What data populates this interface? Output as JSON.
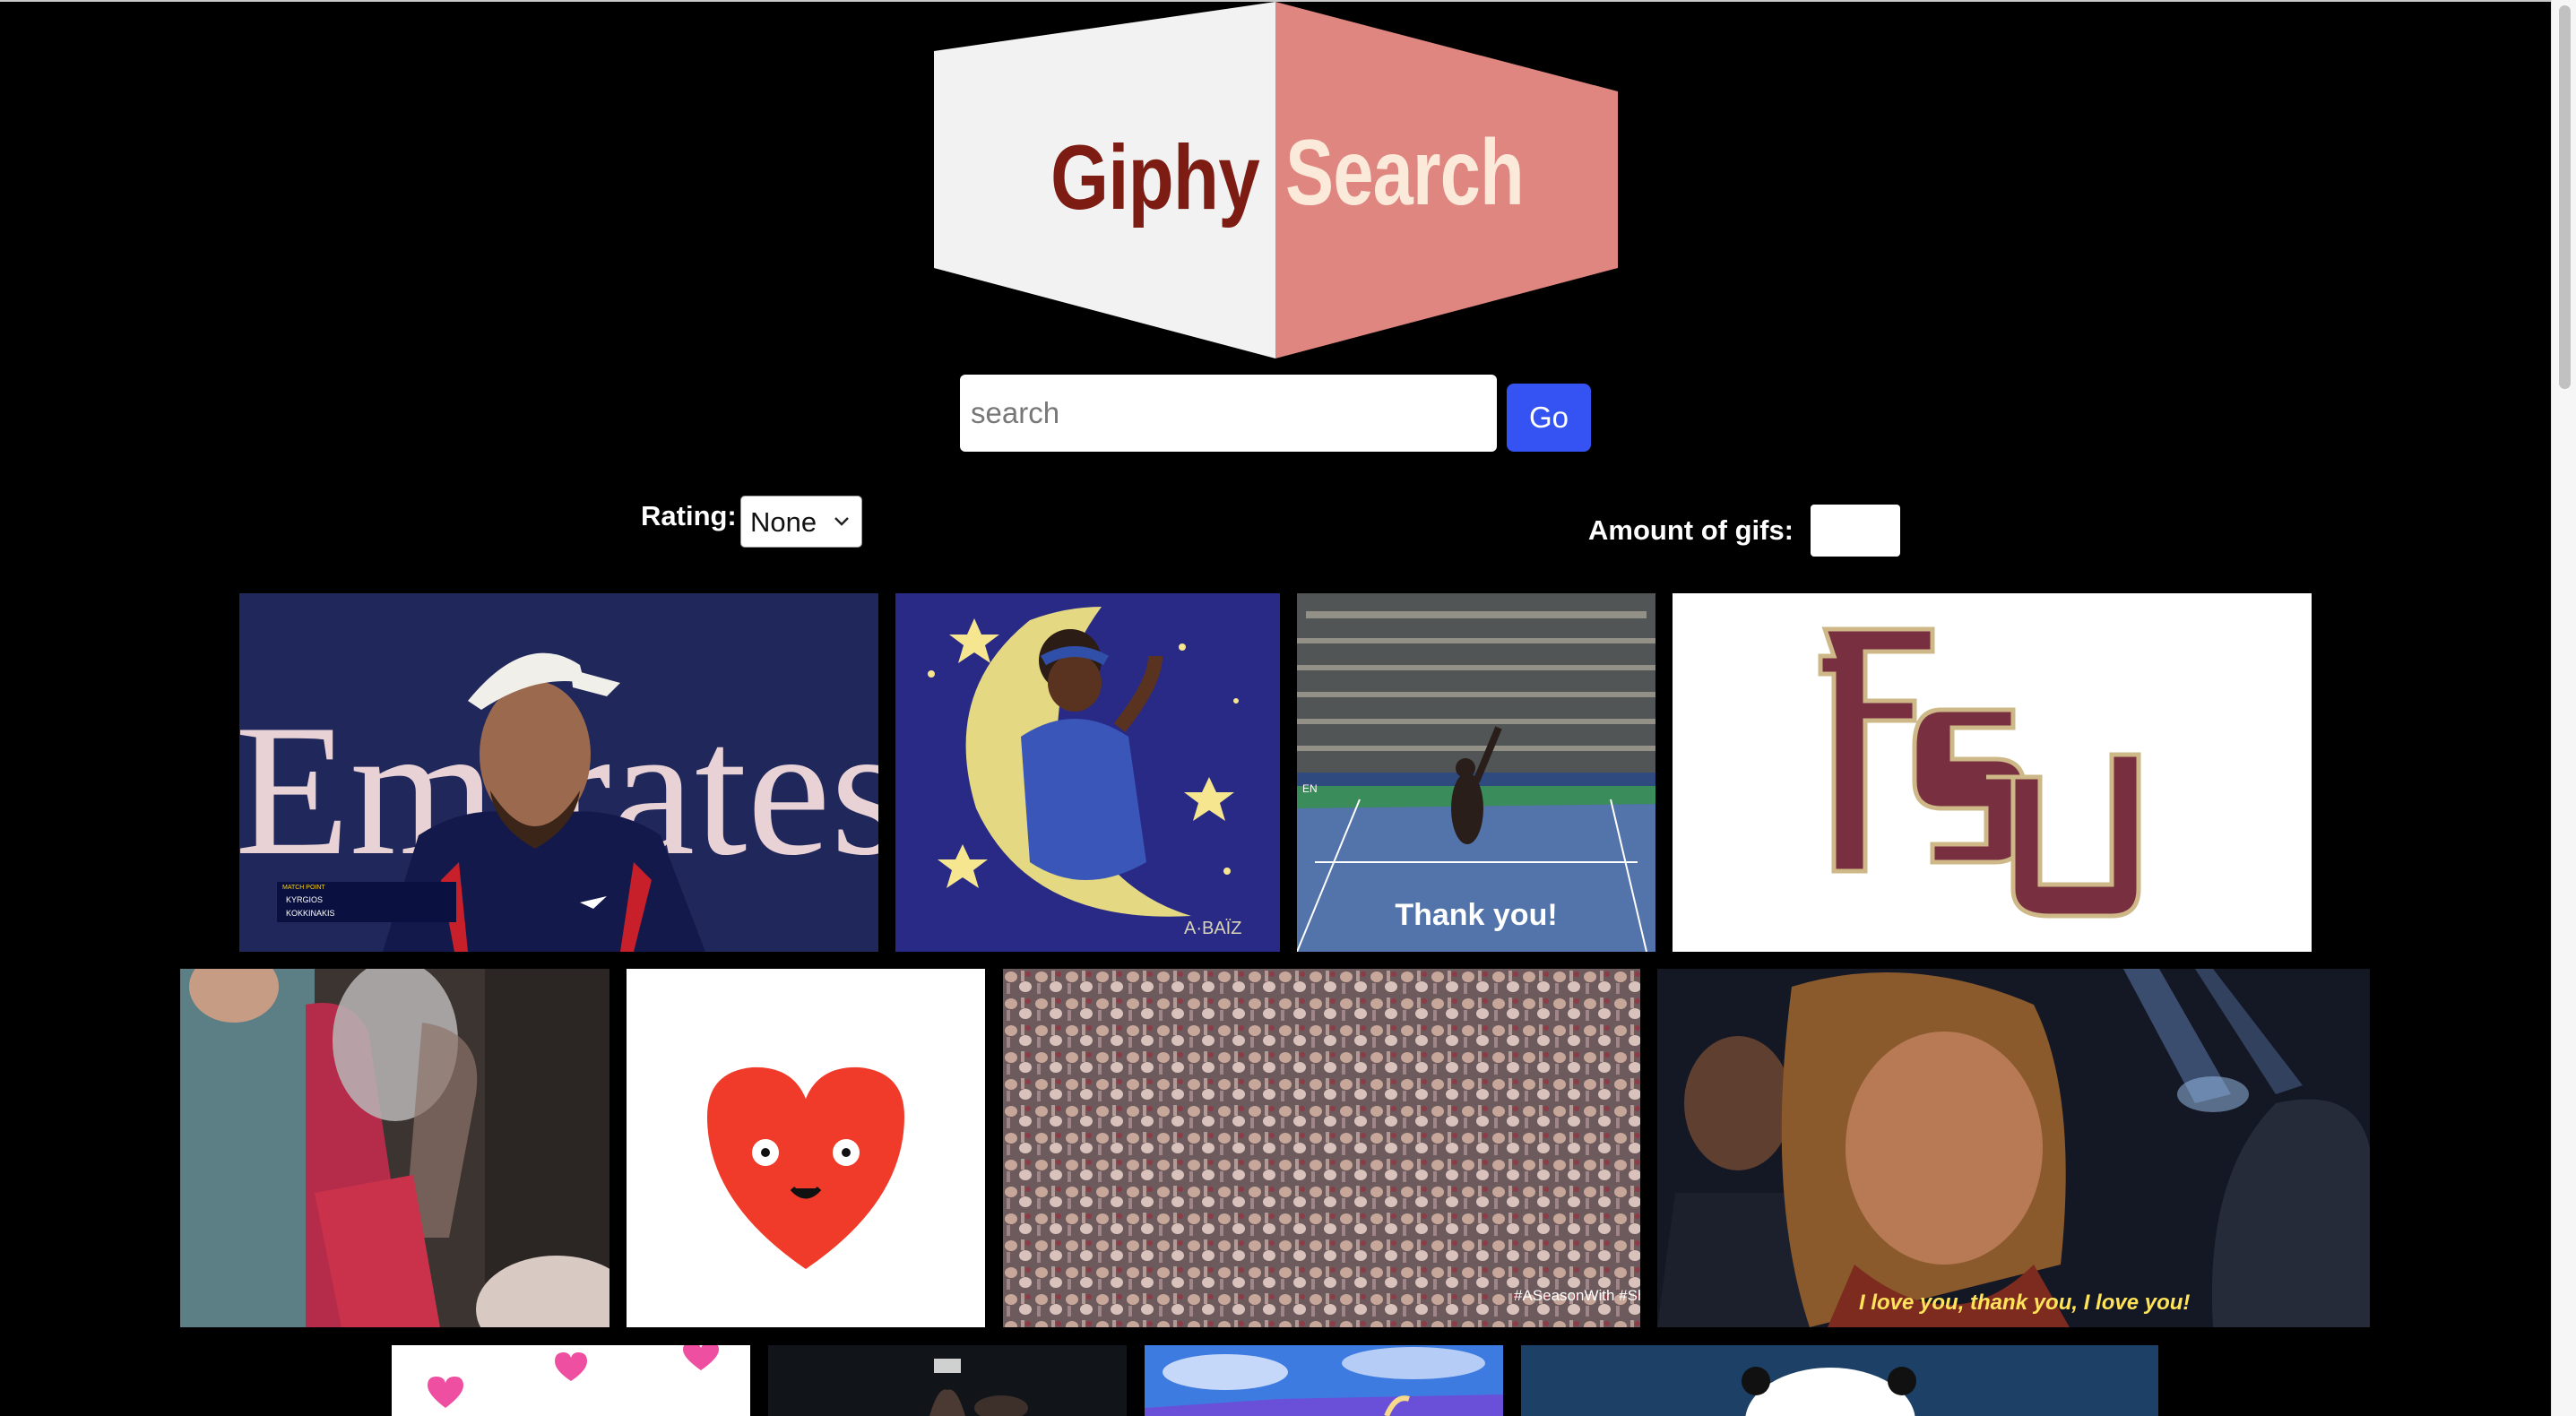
{
  "logo": {
    "left_word": "Giphy",
    "right_word": "Search",
    "colors": {
      "left_panel": "#f2f2f2",
      "right_panel": "#e08680",
      "left_text": "#7c1c13",
      "right_text": "#fbe9da"
    }
  },
  "search": {
    "placeholder": "search",
    "value": "",
    "button_label": "Go"
  },
  "controls": {
    "rating_label": "Rating:",
    "rating_selected": "None",
    "amount_label": "Amount of gifs:",
    "amount_value": ""
  },
  "gifs": [
    {
      "subject": "tennis player in white cap",
      "caption": ""
    },
    {
      "subject": "girl sleeping on crescent moon",
      "caption": ""
    },
    {
      "subject": "tennis player waving in stadium",
      "caption": "Thank you!"
    },
    {
      "subject": "FSU logo",
      "caption": ""
    },
    {
      "subject": "girl dancing in crowd",
      "caption": ""
    },
    {
      "subject": "red smiling heart",
      "caption": ""
    },
    {
      "subject": "stadium crowd waving arms",
      "caption": "#ASeasonWith #Showtime"
    },
    {
      "subject": "woman smiling at awards",
      "caption": "I love you, thank you, I love you!"
    },
    {
      "subject": "pink hearts",
      "caption": ""
    },
    {
      "subject": "concert hands",
      "caption": ""
    },
    {
      "subject": "blue sky",
      "caption": ""
    },
    {
      "subject": "panda",
      "caption": ""
    }
  ],
  "tile_texts": {
    "scoreboard_header": "MATCH POINT",
    "scoreboard_p1": "KYRGIOS",
    "scoreboard_p2": "KOKKINAKIS",
    "banner": "Emirates Air",
    "artist": "A·BAÏZ",
    "court": "EN"
  },
  "colors": {
    "background": "#000000",
    "go_button": "#3553f2"
  }
}
